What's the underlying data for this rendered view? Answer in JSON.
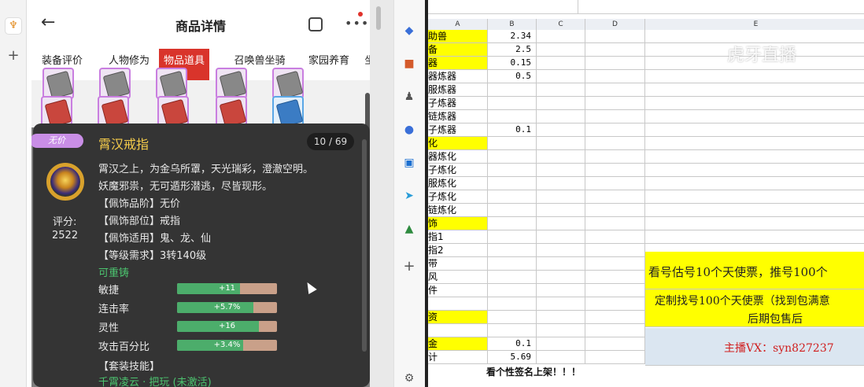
{
  "header": {
    "title": "商品详情"
  },
  "tabs": [
    "装备评价",
    "人物修为",
    "物品道具",
    "召唤兽坐骑",
    "家园养育",
    "坐"
  ],
  "active_tab": 2,
  "item": {
    "badge": "无价",
    "name": "霄汉戒指",
    "counter": "10 / 69",
    "score_label": "评分:",
    "score_value": "2522",
    "desc1": "霄汉之上，为金乌所罩，天光瑞彩，澄澈空明。",
    "desc2": "妖魔邪祟，无可遁形潜逃，尽皆现形。",
    "attr1": "【佩饰品阶】无价",
    "attr2": "【佩饰部位】戒指",
    "attr3": "【佩饰适用】鬼、龙、仙",
    "attr4": "【等级需求】3转140级",
    "recast": "可重铸",
    "stats": [
      {
        "label": "敏捷",
        "value": "+11",
        "fill": 0.63
      },
      {
        "label": "连击率",
        "value": "+5.7%",
        "fill": 0.76
      },
      {
        "label": "灵性",
        "value": "+16",
        "fill": 0.82
      },
      {
        "label": "攻击百分比",
        "value": "+3.4%",
        "fill": 0.66
      }
    ],
    "set_skill_label": "【套装技能】",
    "set_skill": "千霄凌云 · 把玩 (未激活)"
  },
  "sheet": {
    "columns": [
      "A",
      "B",
      "C",
      "D",
      "E"
    ],
    "rows": [
      {
        "a": "助兽",
        "b": "2.34",
        "ya": true
      },
      {
        "a": "备",
        "b": "2.5",
        "ya": true
      },
      {
        "a": "器",
        "b": "0.15",
        "ya": true
      },
      {
        "a": "器炼器",
        "b": "0.5",
        "ya": false
      },
      {
        "a": "服炼器",
        "b": "",
        "ya": false
      },
      {
        "a": "子炼器",
        "b": "",
        "ya": false
      },
      {
        "a": "链炼器",
        "b": "",
        "ya": false
      },
      {
        "a": "子炼器",
        "b": "0.1",
        "ya": false
      },
      {
        "a": "化",
        "b": "",
        "ya": true
      },
      {
        "a": "器炼化",
        "b": "",
        "ya": false
      },
      {
        "a": "子炼化",
        "b": "",
        "ya": false
      },
      {
        "a": "服炼化",
        "b": "",
        "ya": false
      },
      {
        "a": "子炼化",
        "b": "",
        "ya": false
      },
      {
        "a": "链炼化",
        "b": "",
        "ya": false
      },
      {
        "a": "饰",
        "b": "",
        "ya": true
      },
      {
        "a": "指1",
        "b": "",
        "ya": false
      },
      {
        "a": "指2",
        "b": "",
        "ya": false
      },
      {
        "a": "带",
        "b": "",
        "ya": false
      },
      {
        "a": "风",
        "b": "",
        "ya": false
      },
      {
        "a": "件",
        "b": "",
        "ya": false
      },
      {
        "a": "",
        "b": "",
        "ya": false
      },
      {
        "a": "资",
        "b": "",
        "ya": true
      },
      {
        "a": "",
        "b": "",
        "ya": false
      },
      {
        "a": "金",
        "b": "0.1",
        "ya": true
      },
      {
        "a": "计",
        "b": "5.69",
        "ya": false
      }
    ],
    "promo1": "看号估号10个天使票，推号100个",
    "promo2": "定制找号100个天使票（找到包满意",
    "promo3": "后期包售后",
    "promo4": "主播VX：syn827237",
    "footer": "看个性签名上架！！！",
    "watermark": "虎牙直播"
  }
}
